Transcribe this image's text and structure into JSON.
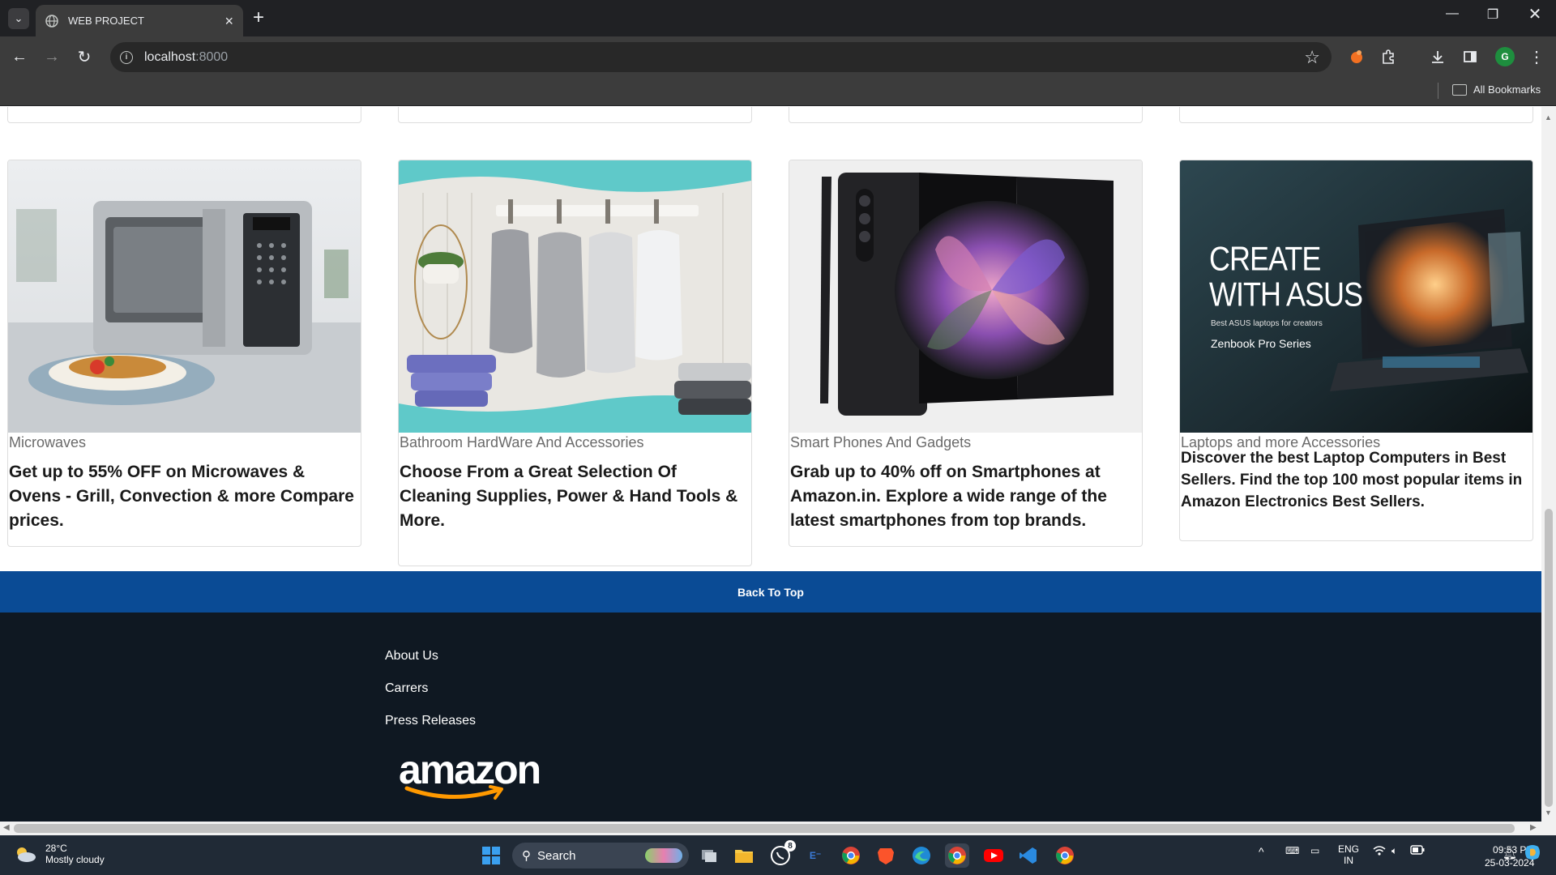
{
  "browser": {
    "tab_title": "WEB PROJECT",
    "url_host": "localhost",
    "url_port": ":8000",
    "bookmarks_label": "All Bookmarks",
    "profile_initial": "G"
  },
  "products": [
    {
      "category": "Microwaves",
      "description": "Get up to 55% OFF on Microwaves & Ovens - Grill, Convection & more Compare prices."
    },
    {
      "category": "Bathroom HardWare And Accessories",
      "description": "Choose From a Great Selection Of Cleaning Supplies, Power & Hand Tools & More."
    },
    {
      "category": "Smart Phones And Gadgets",
      "description": "Grab up to 40% off on Smartphones at Amazon.in. Explore a wide range of the latest smartphones from top brands."
    },
    {
      "category": "Laptops and more Accessories",
      "description": "Discover the best Laptop Computers in Best Sellers. Find the top 100 most popular items in Amazon Electronics Best Sellers.",
      "image_text": {
        "headline_1": "CREATE",
        "headline_2": "WITH ASUS",
        "sub": "Best ASUS laptops for creators",
        "series": "Zenbook Pro Series"
      }
    }
  ],
  "back_to_top": "Back To Top",
  "footer": {
    "links": [
      "About Us",
      "Carrers",
      "Press Releases"
    ],
    "logo_text": "amazon"
  },
  "taskbar": {
    "temperature": "28°C",
    "weather": "Mostly cloudy",
    "search_placeholder": "Search",
    "whatsapp_badge": "8",
    "lang_1": "ENG",
    "lang_2": "IN",
    "time": "09:53 PM",
    "date": "25-03-2024"
  }
}
